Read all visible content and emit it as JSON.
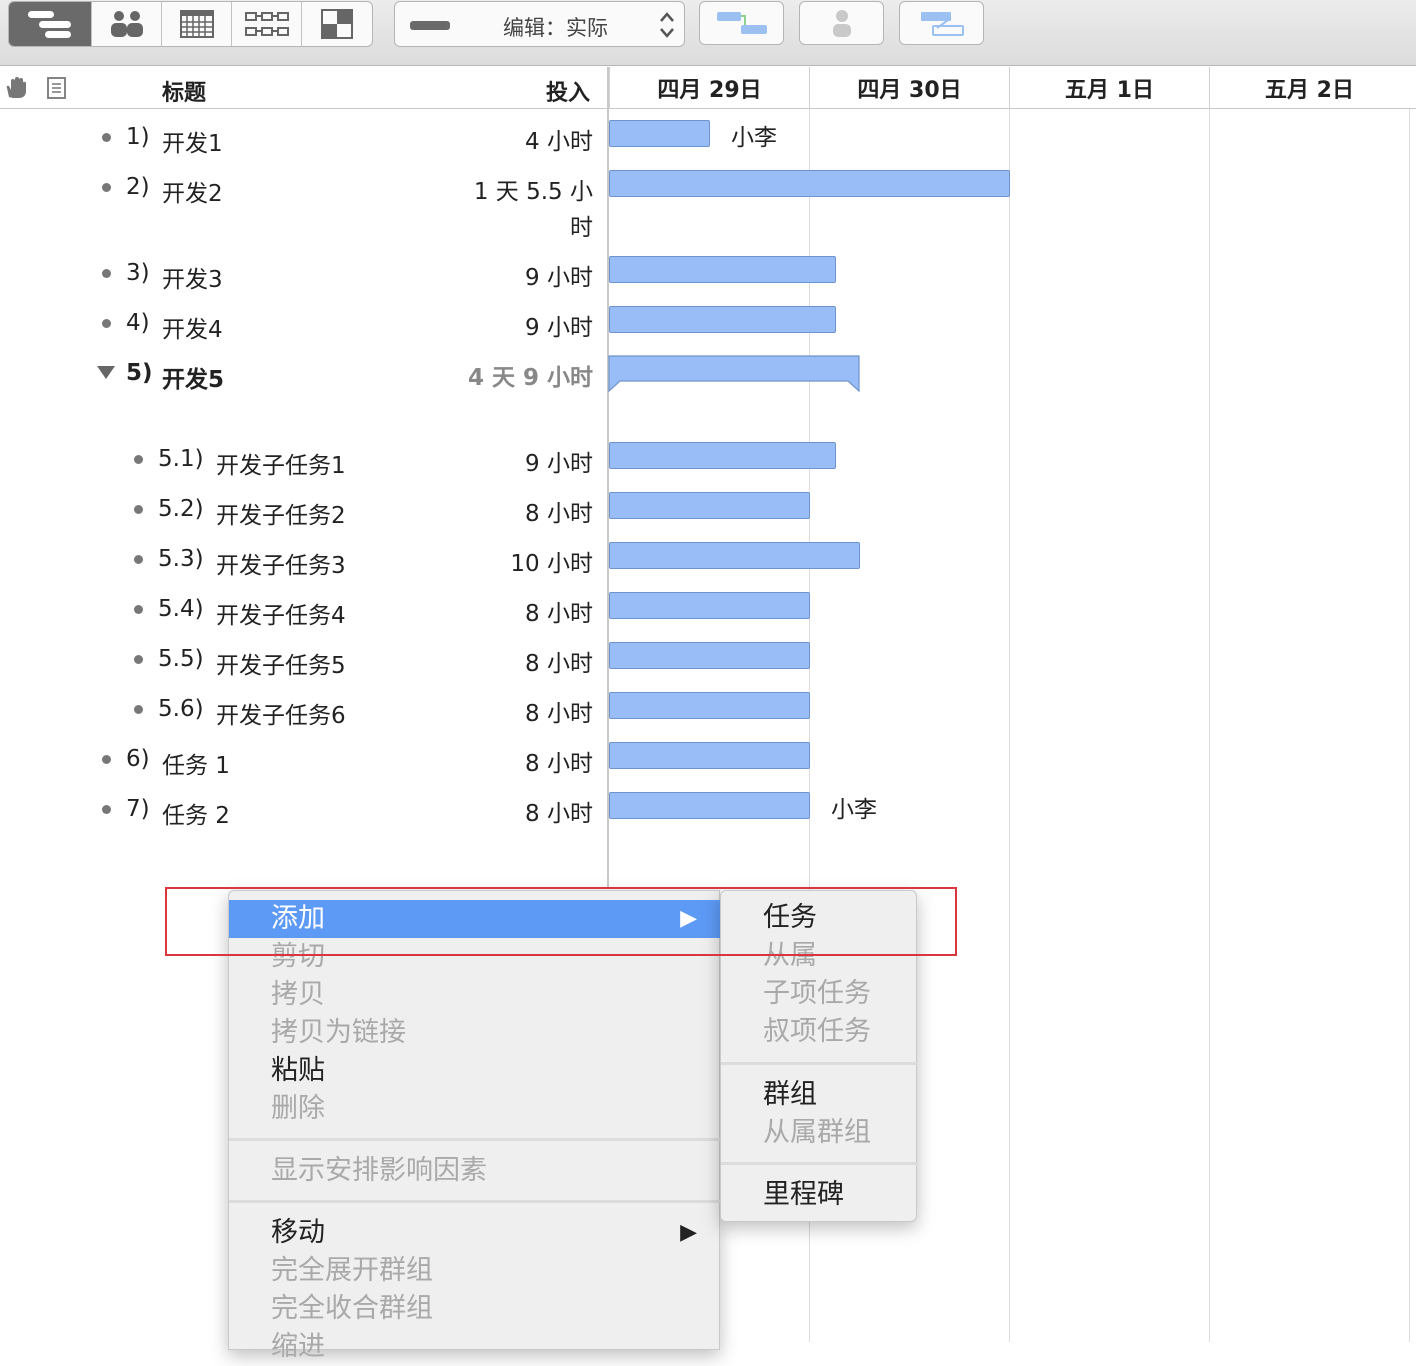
{
  "toolbar": {
    "views": [
      {
        "icon": "gantt-view-icon",
        "active": true
      },
      {
        "icon": "resources-view-icon",
        "active": false
      },
      {
        "icon": "calendar-view-icon",
        "active": false
      },
      {
        "icon": "network-view-icon",
        "active": false
      },
      {
        "icon": "styles-view-icon",
        "active": false
      }
    ],
    "edit_mode": "编辑：实际",
    "buttons": [
      "connect-tasks-icon",
      "assign-resource-icon",
      "add-milestone-icon"
    ]
  },
  "columns": {
    "title": "标题",
    "effort": "投入",
    "dates": [
      "四月 29日",
      "四月 30日",
      "五月 1日",
      "五月 2日"
    ]
  },
  "tasks": [
    {
      "num": "1)",
      "title": "开发1",
      "effort": "4 小时",
      "resource": "小李",
      "group": false,
      "child": false
    },
    {
      "num": "2)",
      "title": "开发2",
      "effort": "1 天 5.5 小时",
      "resource": "",
      "group": false,
      "child": false
    },
    {
      "num": "3)",
      "title": "开发3",
      "effort": "9 小时",
      "resource": "",
      "group": false,
      "child": false
    },
    {
      "num": "4)",
      "title": "开发4",
      "effort": "9 小时",
      "resource": "",
      "group": false,
      "child": false
    },
    {
      "num": "5)",
      "title": "开发5",
      "effort": "4 天 9 小时",
      "resource": "",
      "group": true,
      "child": false
    },
    {
      "num": "5.1)",
      "title": "开发子任务1",
      "effort": "9 小时",
      "resource": "",
      "group": false,
      "child": true
    },
    {
      "num": "5.2)",
      "title": "开发子任务2",
      "effort": "8 小时",
      "resource": "",
      "group": false,
      "child": true
    },
    {
      "num": "5.3)",
      "title": "开发子任务3",
      "effort": "10 小时",
      "resource": "",
      "group": false,
      "child": true
    },
    {
      "num": "5.4)",
      "title": "开发子任务4",
      "effort": "8 小时",
      "resource": "",
      "group": false,
      "child": true
    },
    {
      "num": "5.5)",
      "title": "开发子任务5",
      "effort": "8 小时",
      "resource": "",
      "group": false,
      "child": true
    },
    {
      "num": "5.6)",
      "title": "开发子任务6",
      "effort": "8 小时",
      "resource": "",
      "group": false,
      "child": true
    },
    {
      "num": "6)",
      "title": "任务 1",
      "effort": "8 小时",
      "resource": "",
      "group": false,
      "child": false
    },
    {
      "num": "7)",
      "title": "任务 2",
      "effort": "8 小时",
      "resource": "小李",
      "group": false,
      "child": false
    }
  ],
  "context_menu": {
    "items": [
      {
        "label": "添加",
        "enabled": true,
        "highlighted": true,
        "submenu": true
      },
      {
        "label": "剪切",
        "enabled": false
      },
      {
        "label": "拷贝",
        "enabled": false
      },
      {
        "label": "拷贝为链接",
        "enabled": false
      },
      {
        "label": "粘贴",
        "enabled": true
      },
      {
        "label": "删除",
        "enabled": false
      },
      {
        "label": "显示安排影响因素",
        "enabled": false
      },
      {
        "label": "移动",
        "enabled": true,
        "submenu": true
      },
      {
        "label": "完全展开群组",
        "enabled": false
      },
      {
        "label": "完全收合群组",
        "enabled": false
      },
      {
        "label": "缩进",
        "enabled": false
      }
    ],
    "submenu_add": [
      {
        "label": "任务",
        "enabled": true
      },
      {
        "label": "从属",
        "enabled": false
      },
      {
        "label": "子项任务",
        "enabled": false
      },
      {
        "label": "叔项任务",
        "enabled": false
      },
      {
        "label": "群组",
        "enabled": true
      },
      {
        "label": "从属群组",
        "enabled": false
      },
      {
        "label": "里程碑",
        "enabled": true
      }
    ]
  },
  "colors": {
    "bar_fill": "#99bdf6",
    "bar_border": "#6f93cc",
    "menu_highlight": "#5d9af5",
    "annotation_box": "#d9363e"
  }
}
